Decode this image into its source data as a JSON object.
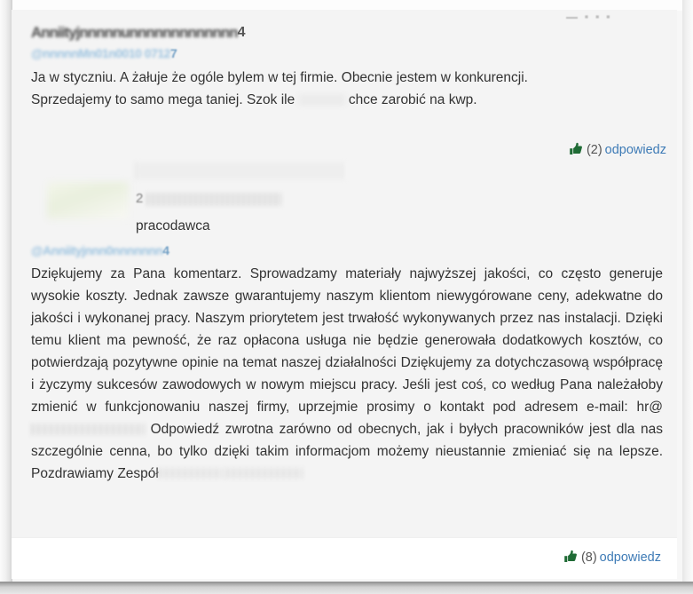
{
  "page": {
    "background_color": "#f4f4f4",
    "card_background": "#f4f4f4",
    "footer_background": "#ffffff",
    "link_color": "#3e7bb6",
    "thumb_color": "#1f6b35",
    "text_color": "#333333",
    "mention_color": "#9cc3e0"
  },
  "top_cutoff": {
    "fragment": "▬ ▪ ▪   ▪"
  },
  "comment": {
    "author_redacted": "Anniityjnnnnnunnnnnnnnnnnnn",
    "author_suffix": "4",
    "mention_redacted": "@nnnnnMn01n0010 0712",
    "mention_suffix": "7",
    "body_line_1": "Ja w styczniu. A żałuje że ogóle bylem w tej firmie. Obecnie jestem w konkurencji.",
    "body_line_2_before": "Sprzedajemy to samo mega taniej. Szok ile",
    "body_line_2_after": "chce zarobić na kwp.",
    "actions": {
      "icon": "thumbs-up-icon",
      "vote_count": "(2)",
      "reply_label": "odpowiedz"
    }
  },
  "employer_reply": {
    "logo": "employer-logo-redacted",
    "company_name_redacted": "",
    "date_lead": "2",
    "date_redacted": "",
    "role_label": "pracodawca",
    "mention_redacted": "@Anniityjnnn0nnnnnnn",
    "mention_suffix": "4",
    "body_paragraph": "Dziękujemy za Pana komentarz. Sprowadzamy materiały najwyższej jakości, co często generuje wysokie koszty. Jednak zawsze gwarantujemy naszym klientom niewygórowane ceny, adekwatne do jakości i wykonanej pracy. Naszym priorytetem jest trwałość wykonywanych przez nas instalacji. Dzięki temu klient ma pewność, że raz opłacona usługa nie będzie generowała dodatkowych kosztów, co potwierdzają pozytywne opinie na temat naszej działalności Dziękujemy za dotychczasową współpracę i życzymy sukcesów zawodowych w nowym miejscu pracy. Jeśli jest coś, co według Pana należałoby zmienić w funkcjonowaniu naszej firmy, uprzejmie prosimy o kontakt pod adresem e-mail: hr@",
    "body_paragraph_after_email": "Odpowiedź zwrotna zarówno od obecnych, jak i byłych pracowników jest dla nas szczególnie cenna, bo tylko dzięki takim informacjom możemy nieustannie zmieniać się na lepsze. Pozdrawiamy Zespół",
    "email_redacted": "",
    "team_redacted": "",
    "signature_redacted": "",
    "actions": {
      "icon": "thumbs-up-icon",
      "vote_count": "(8)",
      "reply_label": "odpowiedz"
    }
  }
}
